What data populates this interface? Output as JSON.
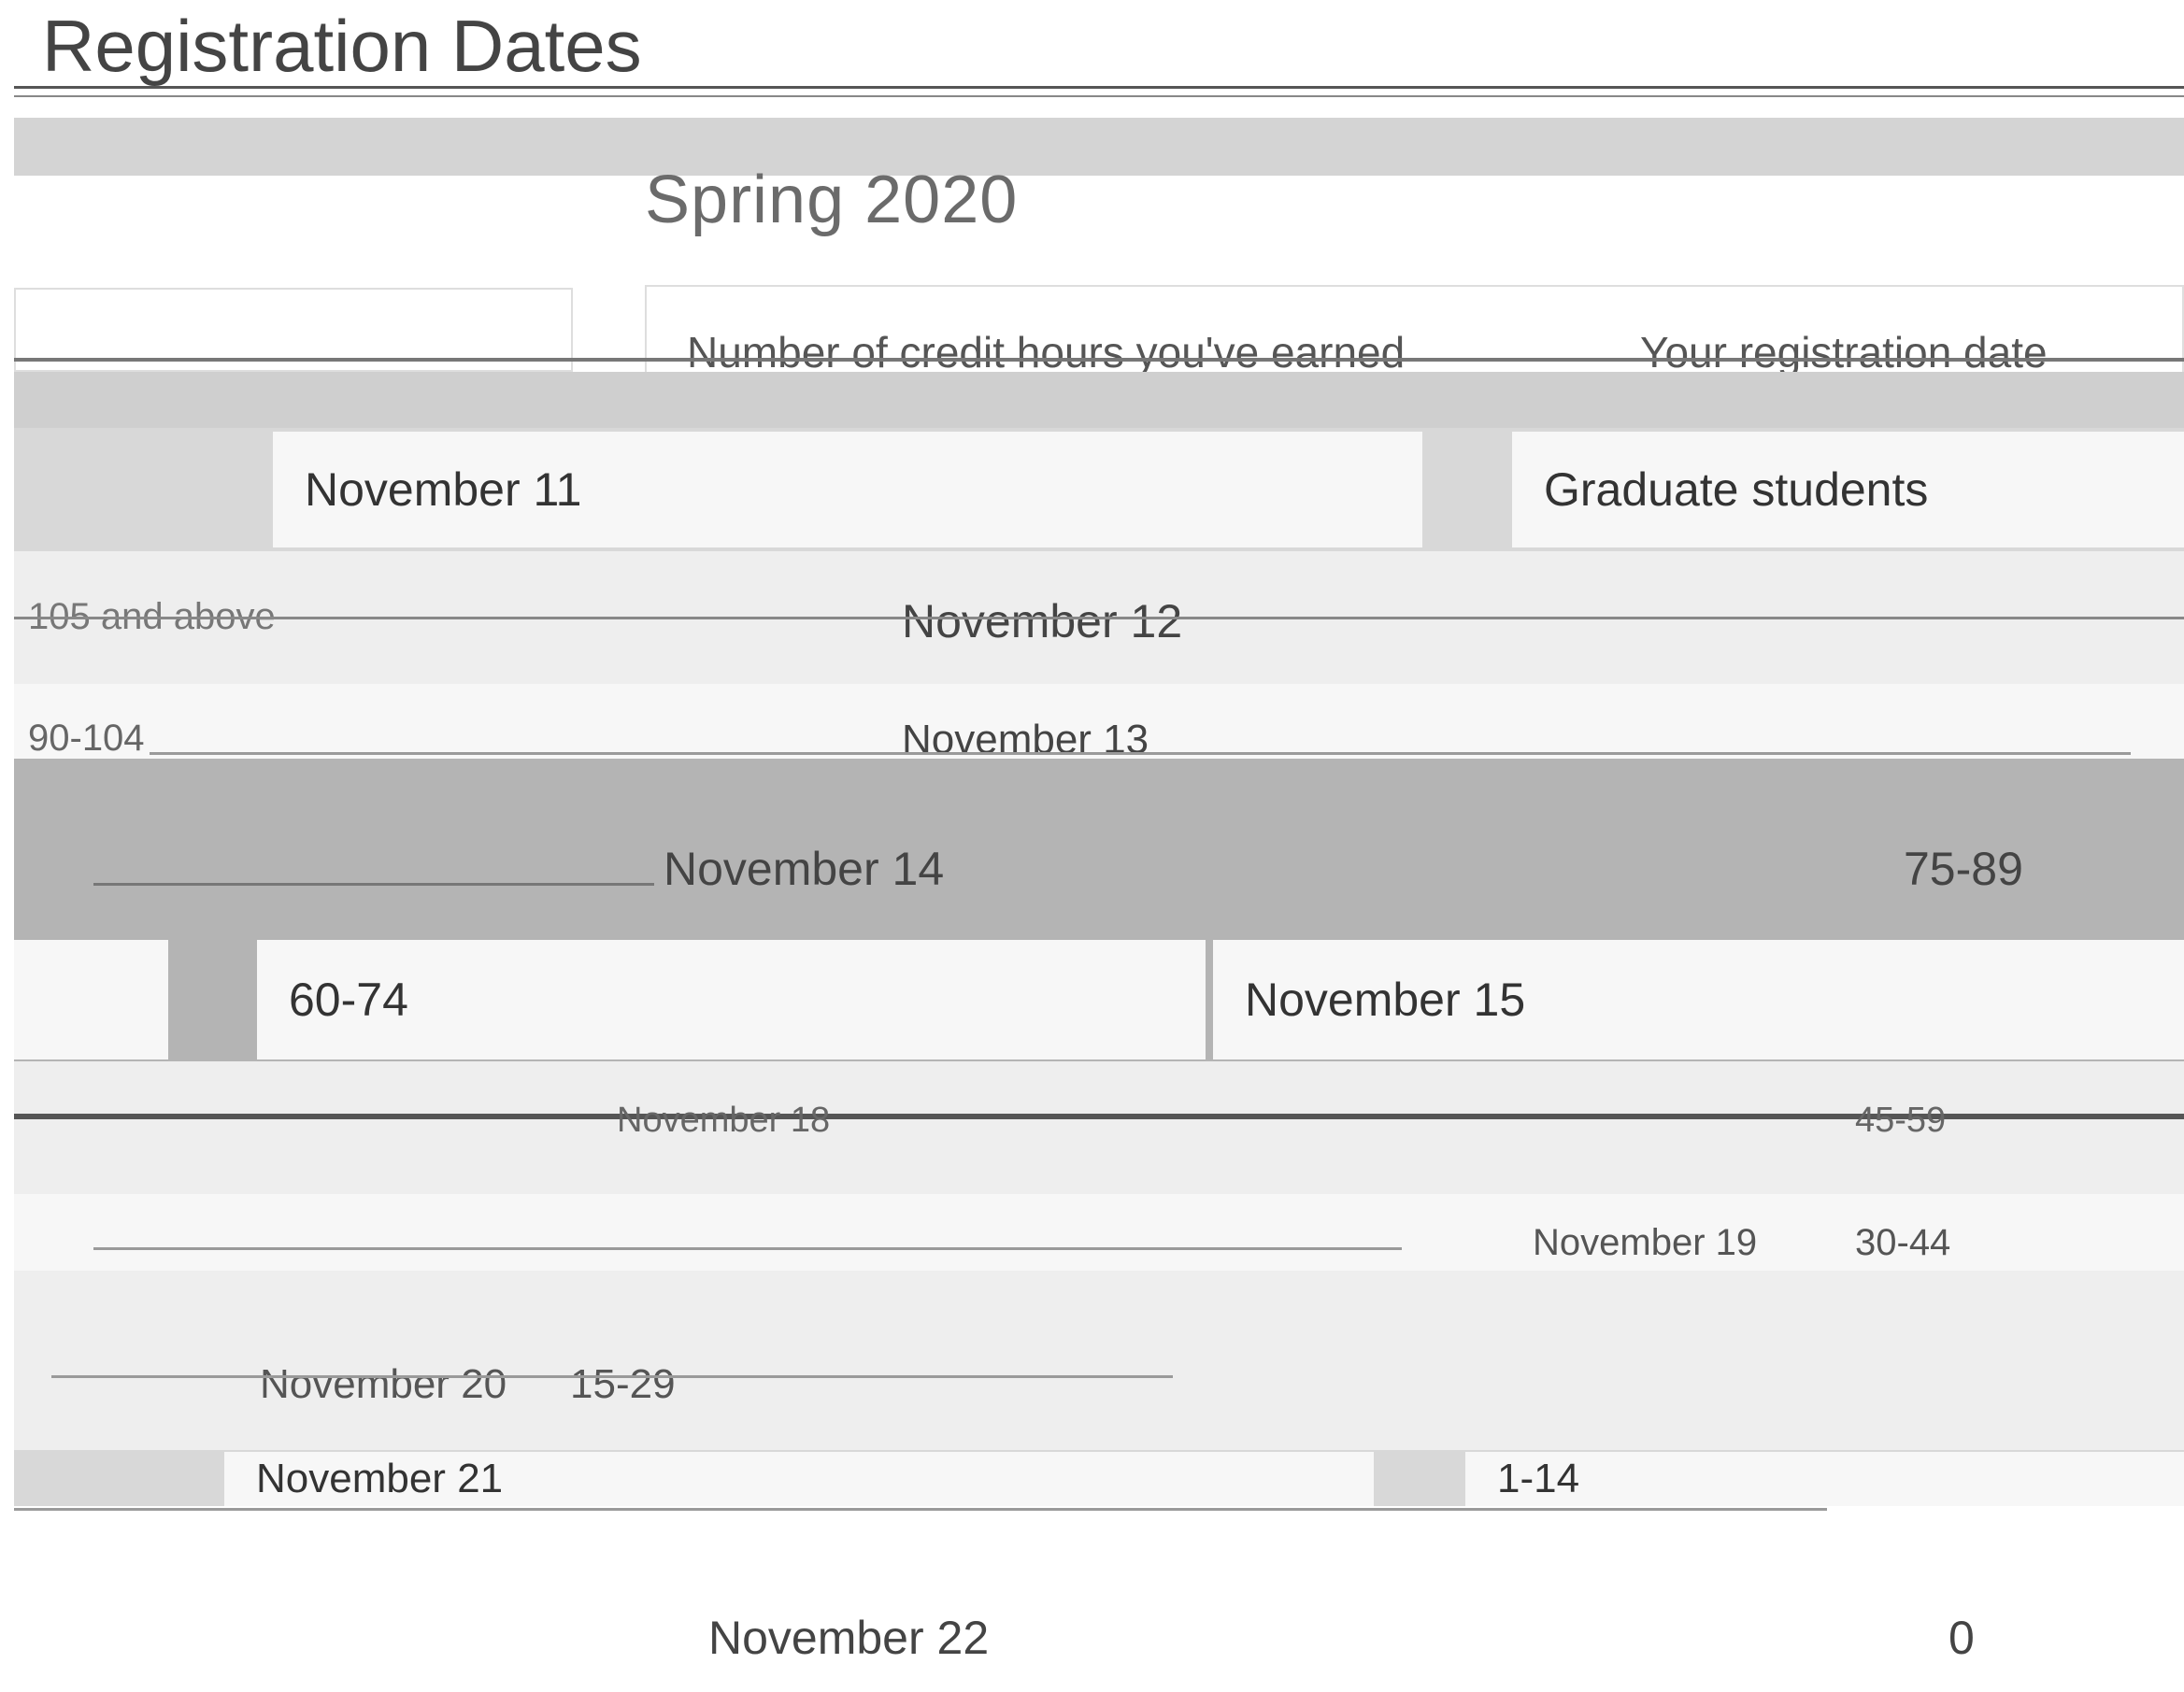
{
  "page": {
    "title": "Registration Dates",
    "term": "Spring 2020"
  },
  "table": {
    "headers": [
      "Number of credit hours you've earned",
      "Your registration date"
    ],
    "rows": [
      {
        "credits": "Graduate students",
        "date": "November 11"
      },
      {
        "credits": "105 and above",
        "date": "November 12"
      },
      {
        "credits": "90-104",
        "date": "November 13"
      },
      {
        "credits": "75-89",
        "date": "November 14"
      },
      {
        "credits": "60-74",
        "date": "November 15"
      },
      {
        "credits": "45-59",
        "date": "November 18"
      },
      {
        "credits": "30-44",
        "date": "November 19"
      },
      {
        "credits": "15-29",
        "date": "November 20"
      },
      {
        "credits": "1-14",
        "date": "November 21"
      },
      {
        "credits": "0",
        "date": "November 22"
      }
    ]
  },
  "colors": {
    "band": "#d4d4d4",
    "row_light": "#eeeeee",
    "row_dark": "#b4b4b4",
    "cell": "#f7f7f7",
    "text": "#333333"
  }
}
